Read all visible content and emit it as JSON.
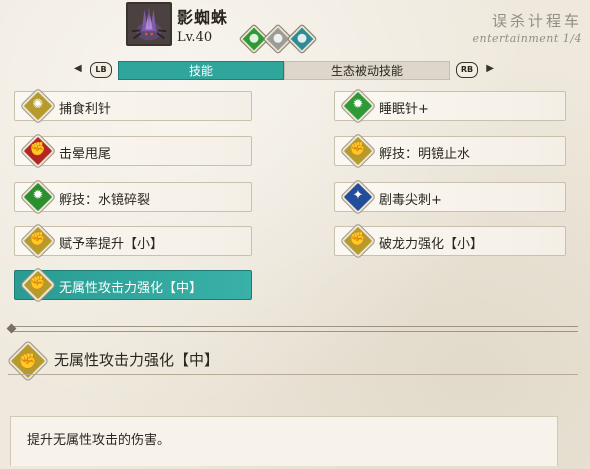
{
  "monster": {
    "name": "影蜘蛛",
    "level": "Lv.40",
    "portrait_icon": "spider-monster-portrait",
    "gene_slots": [
      {
        "color": "#2f9a35",
        "icon": "green-gene-icon"
      },
      {
        "color": "#9c9b96",
        "icon": "neutral-gene-icon"
      },
      {
        "color": "#2e8b93",
        "icon": "water-gene-icon"
      }
    ]
  },
  "watermark": {
    "line1": "误杀计程车",
    "line2": "entertainment 1/4"
  },
  "tabs": {
    "left_key": "LB",
    "right_key": "RB",
    "items": [
      {
        "label": "技能",
        "active": true
      },
      {
        "label": "生态被动技能",
        "active": false
      }
    ]
  },
  "skills_left": [
    {
      "label": "捕食利针",
      "color": "yellow",
      "icon": "sparkle-icon",
      "glyph": "✺"
    },
    {
      "label": "击晕甩尾",
      "color": "red",
      "icon": "power-fist-icon",
      "glyph": "✊"
    },
    {
      "label": "孵技：水镜碎裂",
      "color": "green",
      "icon": "burst-icon",
      "glyph": "✹"
    },
    {
      "label": "赋予率提升【小】",
      "color": "yellow",
      "icon": "power-fist-icon",
      "glyph": "✊"
    },
    {
      "label": "无属性攻击力强化【中】",
      "color": "yellow",
      "icon": "power-fist-icon",
      "glyph": "✊",
      "active": true
    }
  ],
  "skills_right": [
    {
      "label": "睡眠针+",
      "color": "lime",
      "icon": "burst-icon",
      "glyph": "✹"
    },
    {
      "label": "孵技：明镜止水",
      "color": "yellow",
      "icon": "power-fist-icon",
      "glyph": "✊"
    },
    {
      "label": "剧毒尖刺+",
      "color": "blue",
      "icon": "running-figure-icon",
      "glyph": "✦"
    },
    {
      "label": "破龙力强化【小】",
      "color": "yellow",
      "icon": "power-fist-icon",
      "glyph": "✊"
    }
  ],
  "detail": {
    "title": "无属性攻击力强化【中】",
    "glyph": "✊",
    "description": "提升无属性攻击的伤害。"
  }
}
